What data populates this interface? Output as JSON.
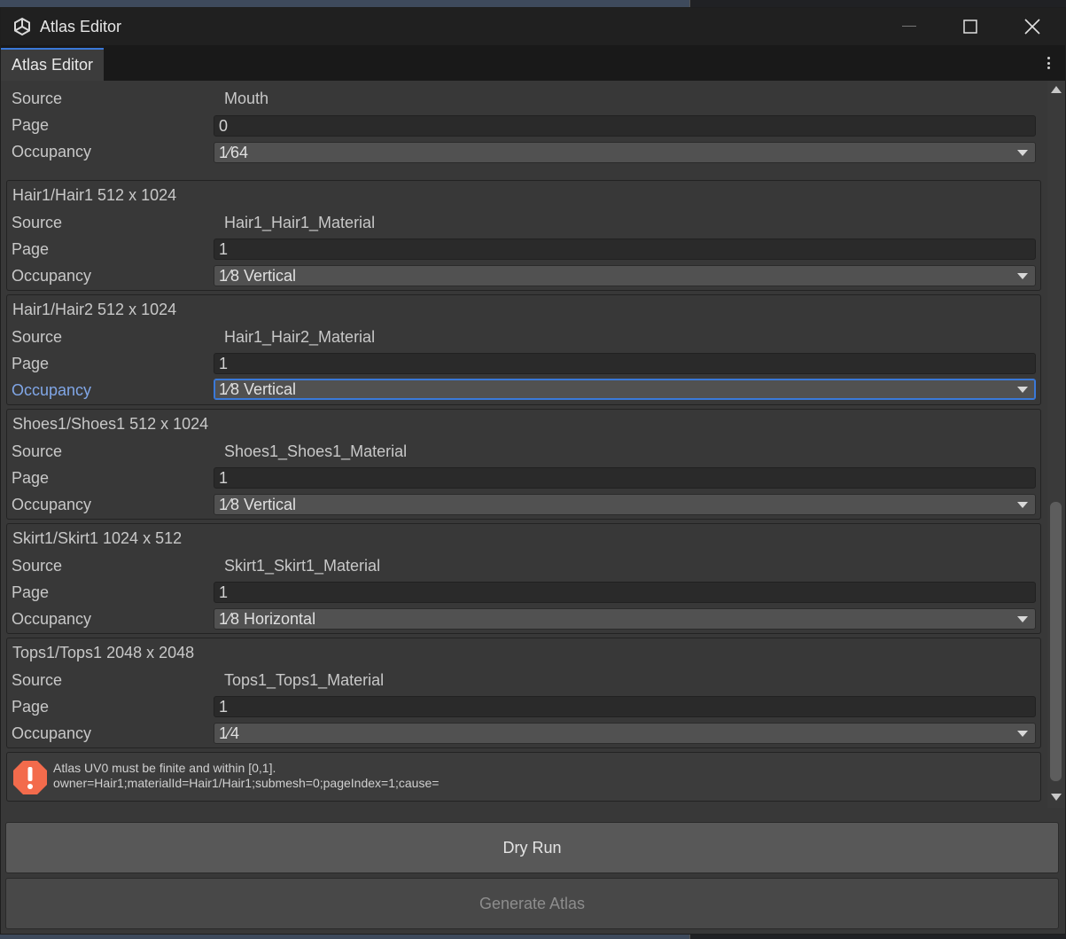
{
  "window": {
    "title": "Atlas Editor"
  },
  "tab": {
    "label": "Atlas Editor"
  },
  "labels": {
    "source": "Source",
    "page": "Page",
    "occupancy": "Occupancy"
  },
  "top_entry": {
    "source": "Mouth",
    "page": "0",
    "occupancy": "1⁄64"
  },
  "entries": [
    {
      "title": "Hair1/Hair1  512 x 1024",
      "source": "Hair1_Hair1_Material",
      "page": "1",
      "occupancy": "1⁄8 Vertical"
    },
    {
      "title": "Hair1/Hair2  512 x 1024",
      "source": "Hair1_Hair2_Material",
      "page": "1",
      "occupancy": "1⁄8 Vertical"
    },
    {
      "title": "Shoes1/Shoes1  512 x 1024",
      "source": "Shoes1_Shoes1_Material",
      "page": "1",
      "occupancy": "1⁄8 Vertical"
    },
    {
      "title": "Skirt1/Skirt1  1024 x 512",
      "source": "Skirt1_Skirt1_Material",
      "page": "1",
      "occupancy": "1⁄8 Horizontal"
    },
    {
      "title": "Tops1/Tops1  2048 x 2048",
      "source": "Tops1_Tops1_Material",
      "page": "1",
      "occupancy": "1⁄4"
    }
  ],
  "help": {
    "line1": "Atlas UV0 must be finite and within [0,1].",
    "line2": "owner=Hair1;materialId=Hair1/Hair1;submesh=0;pageIndex=1;cause="
  },
  "buttons": {
    "dry_run": "Dry Run",
    "generate": "Generate Atlas"
  },
  "colors": {
    "accent": "#3a78d8",
    "warning": "#f36b4c",
    "focus_label": "#80a6e6"
  }
}
